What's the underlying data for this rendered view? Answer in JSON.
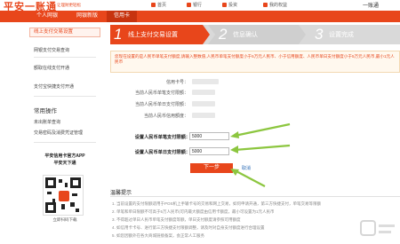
{
  "header": {
    "logo": "平安一账通",
    "slogan": "让理财更轻松",
    "nav": [
      {
        "label": "首页",
        "icon": "home-icon"
      },
      {
        "label": "银行",
        "icon": "bank-icon"
      },
      {
        "label": "投资",
        "icon": "invest-icon"
      },
      {
        "label": "我的权益",
        "icon": "benefit-icon"
      }
    ],
    "brand_right": "一账通",
    "tabs": [
      "个人网银",
      "网银新版",
      "信用卡"
    ],
    "active_tab": "信用卡"
  },
  "sidebar": {
    "active": "线上支付交易设置",
    "items": [
      "网银支付交易查询",
      "额取在线支付开通",
      "支付宝快捷支付开通"
    ],
    "section": "常用操作",
    "ops": [
      "未出账单查询",
      "交易密码及消费凭证管理"
    ],
    "app_title": "平安信用卡官方APP",
    "app_subtitle": "平安天下通",
    "download": "立即扫码下载"
  },
  "steps": [
    {
      "num": "1",
      "label": "线上支付交易设置"
    },
    {
      "num": "2",
      "label": "信息确认"
    },
    {
      "num": "3",
      "label": "设置完成"
    }
  ],
  "notice": "您现在设置的是人民币单笔支付额度,请输入整数值,人民币单笔支付额度小于5万元人民币、小于信用额度、人民币单日支付额度小于5万元人民币,最小1元人民币",
  "info": {
    "card_label": "信用卡号：",
    "single_label": "当前人民币单笔支付限额：",
    "daily_label": "当前人民币单日支付限额：",
    "credit_label": "当前人民币信用额度："
  },
  "form": {
    "single_label": "设置人民币单笔支付限额：",
    "single_value": "5000",
    "daily_label": "设置人民币单日支付限额：",
    "daily_value": "5000",
    "next": "下一步",
    "cancel": "取消"
  },
  "tips": {
    "title": "温馨提示",
    "items": [
      "1. 当前设置的支付限额适用于POS机上手输卡号的交易和网上交易，如何申请开通，第三方快捷支付，单笔交易等限额",
      "2. 单笔和单日限额不可高于5万人民币(可内最大额度由信用卡额度，最小可设置为1元人民币",
      "3. 不得超过单日人民币单笔支付额度等额，单日支付额度请参照可用额度",
      "4. 如信用卡卡号、进行第三方快捷支付限额调整，请及时对自身支付额度进行合理设置",
      "5. 如您因额外在各大商城链接备案，会正常人工服务"
    ]
  },
  "colors": {
    "brand": "#e8461b",
    "arrow": "#8cc63f"
  }
}
